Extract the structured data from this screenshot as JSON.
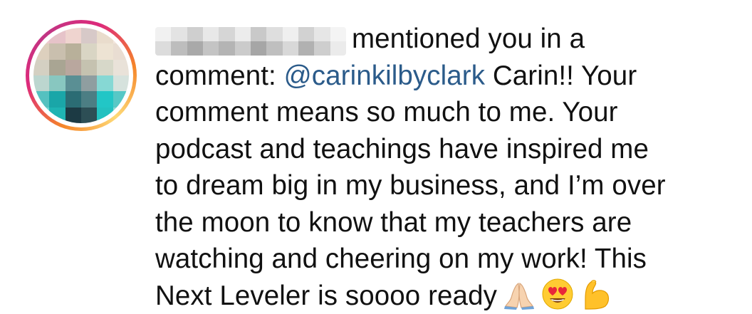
{
  "notification": {
    "avatar_icon": "blurred-profile-avatar",
    "username_redacted": true,
    "action_text": "mentioned you in a",
    "line2_prefix": "comment: ",
    "mention": "@carinkilbyclark",
    "line2_suffix": " Carin!! Your",
    "line3": "comment means so much to me. Your",
    "line4": "podcast and teachings have inspired me",
    "line5": "to dream big in my business, and I’m over",
    "line6": "the moon to know that my teachers are",
    "line7": "watching and cheering on my work! This",
    "line8": "Next Leveler is soooo ready",
    "emojis": [
      "folded-hands-emoji",
      "heart-eyes-emoji",
      "flexed-biceps-emoji"
    ],
    "colors": {
      "text": "#111111",
      "mention": "#2b5b8a",
      "ring_gradient": [
        "#f58529",
        "#dd2a7b",
        "#c13584",
        "#feda77"
      ]
    }
  }
}
